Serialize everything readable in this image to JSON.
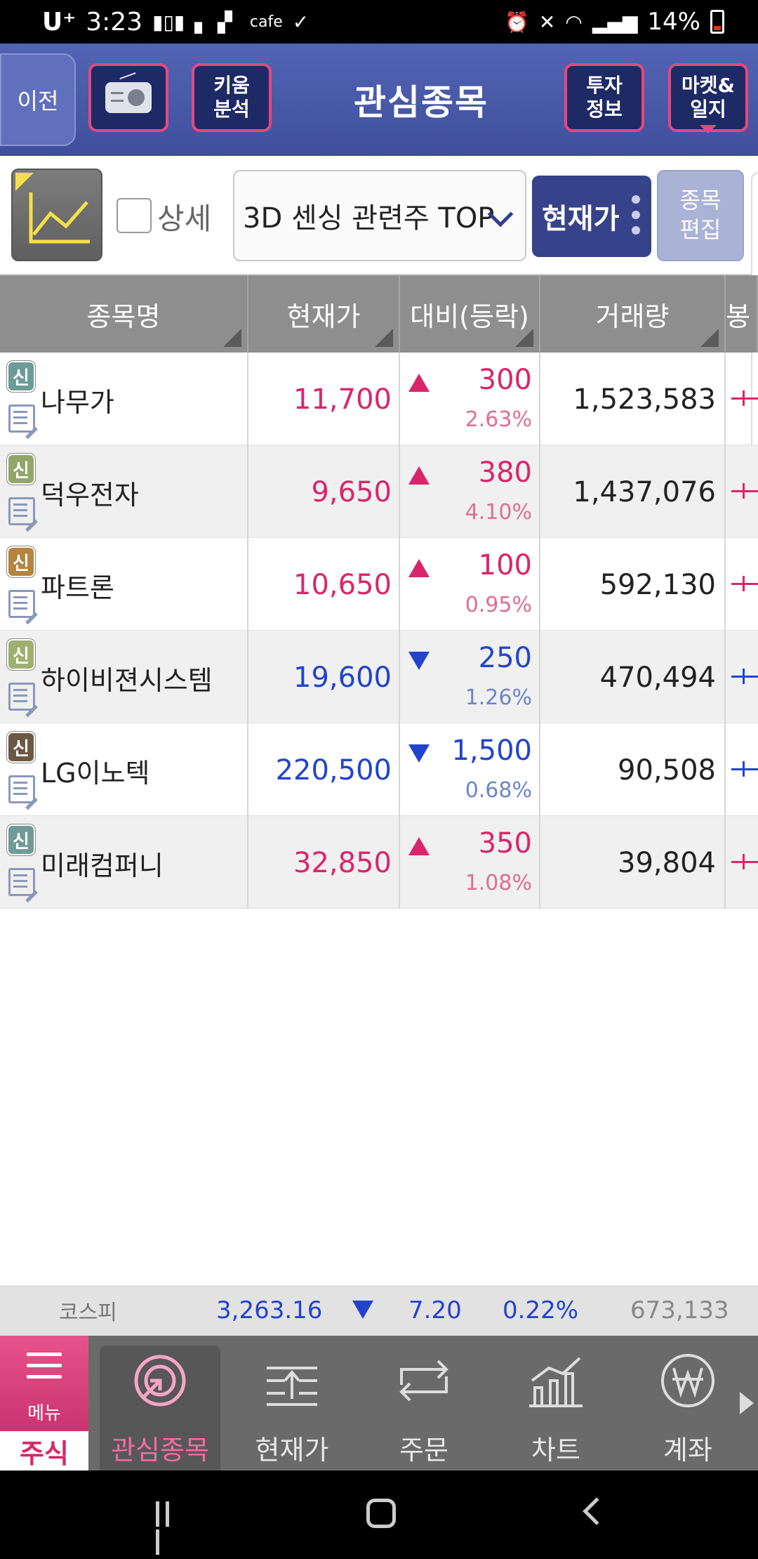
{
  "status_bar": {
    "carrier": "U⁺",
    "time": "3:23",
    "cafe_label": "cafe",
    "battery": "14%"
  },
  "header": {
    "back_label": "이전",
    "kiwoom_label_line1": "키움",
    "kiwoom_label_line2": "분석",
    "title": "관심종목",
    "invest_label_line1": "투자",
    "invest_label_line2": "정보",
    "market_label_line1": "마켓&",
    "market_label_line2": "일지"
  },
  "toolbar": {
    "detail_label": "상세",
    "group_value": "3D 센싱 관련주 TOP",
    "price_button": "현재가",
    "edit_line1": "종목",
    "edit_line2": "편집"
  },
  "table": {
    "headers": [
      "종목명",
      "현재가",
      "대비(등락)",
      "거래량",
      "봉"
    ],
    "rows": [
      {
        "badge": "신",
        "name": "나무가",
        "price": "11,700",
        "direction": "up",
        "change": "300",
        "pct": "2.63%",
        "volume": "1,523,583"
      },
      {
        "badge": "신",
        "name": "덕우전자",
        "price": "9,650",
        "direction": "up",
        "change": "380",
        "pct": "4.10%",
        "volume": "1,437,076"
      },
      {
        "badge": "신",
        "name": "파트론",
        "price": "10,650",
        "direction": "up",
        "change": "100",
        "pct": "0.95%",
        "volume": "592,130"
      },
      {
        "badge": "신",
        "name": "하이비젼시스템",
        "price": "19,600",
        "direction": "down",
        "change": "250",
        "pct": "1.26%",
        "volume": "470,494"
      },
      {
        "badge": "신",
        "name": "LG이노텍",
        "price": "220,500",
        "direction": "down",
        "change": "1,500",
        "pct": "0.68%",
        "volume": "90,508"
      },
      {
        "badge": "신",
        "name": "미래컴퍼니",
        "price": "32,850",
        "direction": "up",
        "change": "350",
        "pct": "1.08%",
        "volume": "39,804"
      }
    ]
  },
  "ticker": {
    "name": "코스피",
    "value": "3,263.16",
    "change": "7.20",
    "pct": "0.22%",
    "volume": "673,133"
  },
  "tabbar": {
    "menu_label": "메뉴",
    "stock_label": "주식",
    "tabs": [
      "관심종목",
      "현재가",
      "주문",
      "차트",
      "계좌"
    ]
  },
  "colors": {
    "header_bg": "#4a5aa8",
    "accent_pink": "#e4487e",
    "up_red": "#d9266a",
    "down_blue": "#2244cc"
  }
}
